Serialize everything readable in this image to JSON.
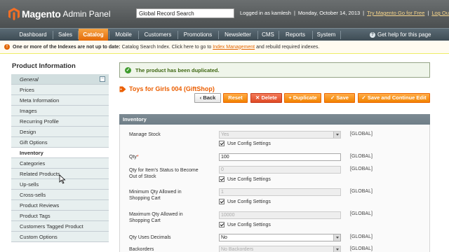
{
  "header": {
    "brand": "Magento",
    "panel": "Admin Panel",
    "search_value": "Global Record Search",
    "logged_in": "Logged in as kamlesh",
    "date": "Monday, October 14, 2013",
    "go_free": "Try Magento Go for Free",
    "logout": "Log Out",
    "separator": "|"
  },
  "nav": {
    "items": [
      "Dashboard",
      "Sales",
      "Catalog",
      "Mobile",
      "Customers",
      "Promotions",
      "Newsletter",
      "CMS",
      "Reports",
      "System"
    ],
    "active": "Catalog",
    "help": "Get help for this page",
    "active_color": "#eb5e00"
  },
  "notice": {
    "bold": "One or more of the Indexes are not up to date:",
    "text1": "Catalog Search Index. Click here to go to",
    "link": "Index Management",
    "text2": "and rebuild required indexes."
  },
  "sidebar": {
    "title": "Product Information",
    "items": [
      {
        "label": "General",
        "type": "group"
      },
      {
        "label": "Prices"
      },
      {
        "label": "Meta Information"
      },
      {
        "label": "Images"
      },
      {
        "label": "Recurring Profile"
      },
      {
        "label": "Design"
      },
      {
        "label": "Gift Options"
      },
      {
        "label": "Inventory",
        "active": true
      },
      {
        "label": "Categories"
      },
      {
        "label": "Related Products"
      },
      {
        "label": "Up-sells"
      },
      {
        "label": "Cross-sells"
      },
      {
        "label": "Product Reviews"
      },
      {
        "label": "Product Tags"
      },
      {
        "label": "Customers Tagged Product"
      },
      {
        "label": "Custom Options"
      }
    ]
  },
  "message": {
    "success": "The product has been duplicated."
  },
  "product": {
    "title": "Toys for Girls 004 (GiftShop)"
  },
  "buttons": {
    "back": "Back",
    "reset": "Reset",
    "delete": "Delete",
    "duplicate": "Duplicate",
    "save": "Save",
    "save_continue": "Save and Continue Edit"
  },
  "inventory": {
    "section_title": "Inventory",
    "scope": "[GLOBAL]",
    "use_config": "Use Config Settings",
    "manage_stock": {
      "label": "Manage Stock",
      "value": "Yes"
    },
    "qty": {
      "label": "Qty",
      "required_mark": "*",
      "value": "100"
    },
    "out_of_stock": {
      "label1": "Qty for Item's Status to Become",
      "label2": "Out of Stock",
      "value": "0"
    },
    "min_qty": {
      "label1": "Minimum Qty Allowed in",
      "label2": "Shopping Cart",
      "value": "1"
    },
    "max_qty": {
      "label1": "Maximum Qty Allowed in",
      "label2": "Shopping Cart",
      "value": "10000"
    },
    "decimals": {
      "label": "Qty Uses Decimals",
      "value": "No"
    },
    "backorders": {
      "label": "Backorders",
      "value": "No Backorders"
    }
  }
}
